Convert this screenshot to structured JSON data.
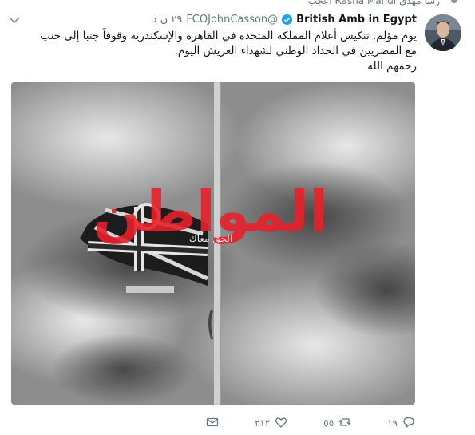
{
  "top_activity": {
    "text": "رشا مهدي Rasha Mahdi أعجب"
  },
  "tweet": {
    "author_name": "British Amb in Egypt",
    "handle": "@FCOJohnCasson",
    "time": "٢٩ ن د",
    "text_lines": [
      "يوم مؤلم.  تنكيس أعلام المملكة المتحدة  في القاهرة والإسكندرية وقوفاً جنبا إلى جنب",
      "مع المصريين في الحداد الوطني لشهداء العريش اليوم.",
      "رحمهم الله"
    ],
    "watermark": "المواطن",
    "watermark_sub": "الحق معاك"
  },
  "actions": {
    "reply_count": "١٩",
    "retweet_count": "٥٥",
    "like_count": "٢١٢"
  },
  "icons": {
    "avatar": "avatar",
    "verified": "verified-badge-icon",
    "menu": "chevron-down-icon",
    "reply": "reply-icon",
    "retweet": "retweet-icon",
    "like": "heart-icon",
    "dm": "direct-message-icon"
  },
  "colors": {
    "verified": "#1da1f2",
    "secondary_text": "#657786",
    "watermark": "#e8202a"
  }
}
